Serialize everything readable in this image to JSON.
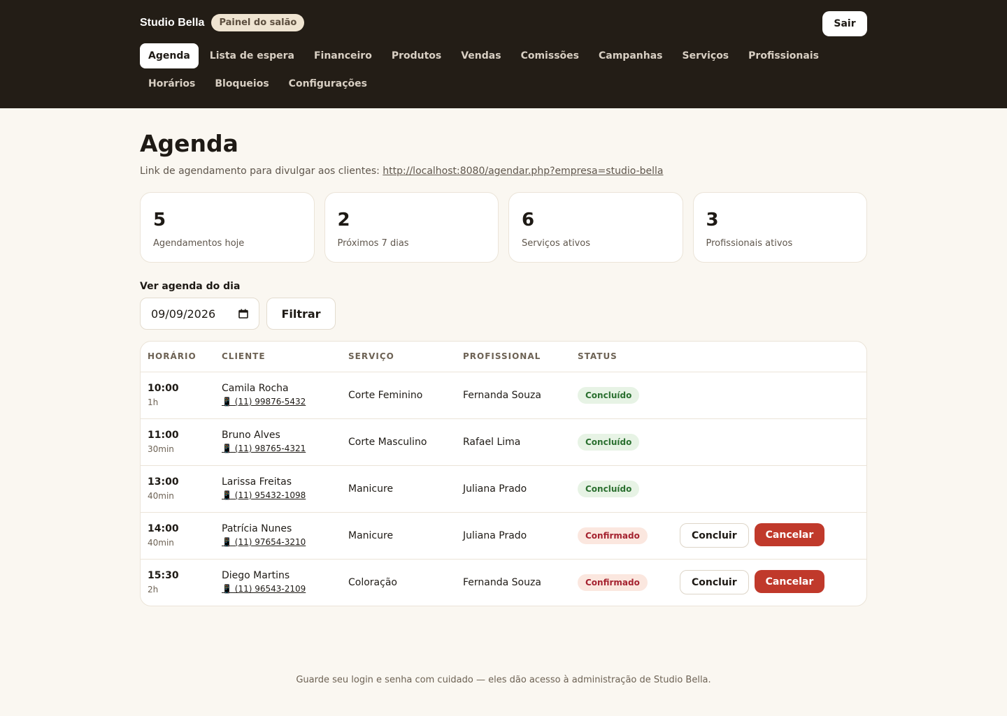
{
  "header": {
    "brand": "Studio Bella",
    "badge": "Painel do salão",
    "logout_label": "Sair",
    "nav": [
      {
        "label": "Agenda",
        "active": true
      },
      {
        "label": "Lista de espera"
      },
      {
        "label": "Financeiro"
      },
      {
        "label": "Produtos"
      },
      {
        "label": "Vendas"
      },
      {
        "label": "Comissões"
      },
      {
        "label": "Campanhas"
      },
      {
        "label": "Serviços"
      },
      {
        "label": "Profissionais"
      },
      {
        "label": "Horários"
      },
      {
        "label": "Bloqueios"
      },
      {
        "label": "Configurações"
      }
    ]
  },
  "page": {
    "title": "Agenda",
    "share_text": "Link de agendamento para divulgar aos clientes:",
    "share_link": "http://localhost:8080/agendar.php?empresa=studio-bella"
  },
  "stats": [
    {
      "value": "5",
      "label": "Agendamentos hoje"
    },
    {
      "value": "2",
      "label": "Próximos 7 dias"
    },
    {
      "value": "6",
      "label": "Serviços ativos"
    },
    {
      "value": "3",
      "label": "Profissionais ativos"
    }
  ],
  "filter": {
    "label": "Ver agenda do dia",
    "date_value": "09/09/2026",
    "button_label": "Filtrar"
  },
  "table": {
    "headers": [
      "HORÁRIO",
      "CLIENTE",
      "SERVIÇO",
      "PROFISSIONAL",
      "STATUS"
    ],
    "rows": [
      {
        "time": "10:00",
        "duration": "1h",
        "client": "Camila Rocha",
        "phone": "📱 (11) 99876-5432",
        "service": "Corte Feminino",
        "professional": "Fernanda Souza",
        "status": "Concluído",
        "actions": false
      },
      {
        "time": "11:00",
        "duration": "30min",
        "client": "Bruno Alves",
        "phone": "📱 (11) 98765-4321",
        "service": "Corte Masculino",
        "professional": "Rafael Lima",
        "status": "Concluído",
        "actions": false
      },
      {
        "time": "13:00",
        "duration": "40min",
        "client": "Larissa Freitas",
        "phone": "📱 (11) 95432-1098",
        "service": "Manicure",
        "professional": "Juliana Prado",
        "status": "Concluído",
        "actions": false
      },
      {
        "time": "14:00",
        "duration": "40min",
        "client": "Patrícia Nunes",
        "phone": "📱 (11) 97654-3210",
        "service": "Manicure",
        "professional": "Juliana Prado",
        "status": "Confirmado",
        "actions": true
      },
      {
        "time": "15:30",
        "duration": "2h",
        "client": "Diego Martins",
        "phone": "📱 (11) 96543-2109",
        "service": "Coloração",
        "professional": "Fernanda Souza",
        "status": "Confirmado",
        "actions": true
      }
    ],
    "action_labels": {
      "complete": "Concluir",
      "cancel": "Cancelar"
    }
  },
  "colors": {
    "header_bg": "#231d16",
    "page_bg": "#faf7f1",
    "cancel_button": "#c0392b",
    "status_done_bg": "#e7f3e5",
    "status_done_text": "#2b7030",
    "status_confirmed_bg": "#fbe7df",
    "status_confirmed_text": "#a52330"
  },
  "icons": {
    "date_picker": "calendar-icon",
    "phone": "phone-icon"
  },
  "footer": {
    "text": "Guarde seu login e senha com cuidado — eles dão acesso à administração de Studio Bella."
  }
}
